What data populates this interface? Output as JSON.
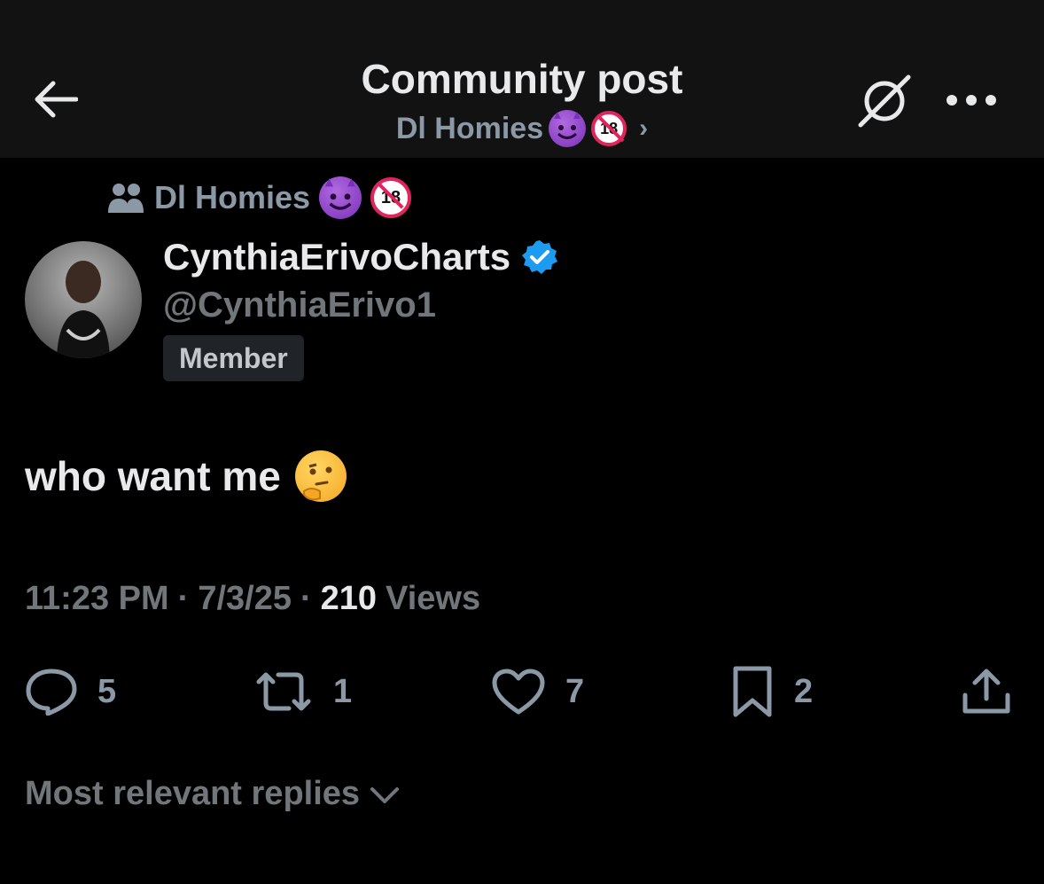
{
  "header": {
    "title": "Community post",
    "community_name": "Dl Homies",
    "community_chevron": "›",
    "back_icon": "arrow-left-icon",
    "grok_icon": "grok-slash-icon",
    "more_label": "•••"
  },
  "community": {
    "name": "Dl Homies",
    "icon": "people-icon"
  },
  "author": {
    "display_name": "CynthiaErivoCharts",
    "handle": "@CynthiaErivo1",
    "verified": true,
    "badge": "Member"
  },
  "post": {
    "text": "who want me"
  },
  "meta": {
    "time": "11:23 PM",
    "sep1": "·",
    "date": "7/3/25",
    "sep2": "·",
    "views_count": "210",
    "views_label": "Views"
  },
  "actions": {
    "replies": "5",
    "reposts": "1",
    "likes": "7",
    "bookmarks": "2"
  },
  "replies_sort": {
    "label": "Most relevant replies"
  },
  "colors": {
    "background": "#000000",
    "header_bg": "#121212",
    "text_primary": "#e7e9ea",
    "text_secondary": "#71767b",
    "verified_blue": "#1d9bf0"
  }
}
